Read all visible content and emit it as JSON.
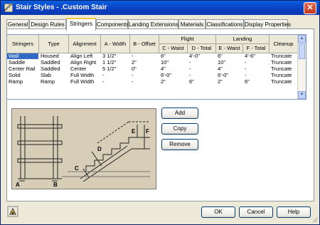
{
  "window": {
    "title": "Stair Styles - .Custom Stair",
    "close_glyph": "✕"
  },
  "tabs": [
    {
      "label": "General",
      "active": false
    },
    {
      "label": "Design Rules",
      "active": false
    },
    {
      "label": "Stringers",
      "active": true
    },
    {
      "label": "Components",
      "active": false
    },
    {
      "label": "Landing Extensions",
      "active": false
    },
    {
      "label": "Materials",
      "active": false
    },
    {
      "label": "Classifications",
      "active": false
    },
    {
      "label": "Display Properties",
      "active": false
    }
  ],
  "grid": {
    "headers": {
      "stringers": "Stringers",
      "type": "Type",
      "alignment": "Alignment",
      "a_width": "A - Width",
      "b_offset": "B - Offset",
      "flight": "Flight",
      "c_waist": "C - Waist",
      "d_total": "D - Total",
      "landing": "Landing",
      "e_waist": "E - Waist",
      "f_total": "F - Total",
      "cleanup": "Cleanup"
    },
    "rows": [
      [
        "Wall",
        "Housed",
        "Align Left",
        "3 1/2\"",
        "-",
        "6\"",
        "4'-0\"",
        "6\"",
        "4'-6\"",
        "Truncate"
      ],
      [
        "Saddle",
        "Saddled",
        "Align Right",
        "1 1/2\"",
        "2\"",
        "10\"",
        "-",
        "10\"",
        "-",
        "Truncate"
      ],
      [
        "Center Rail",
        "Saddled",
        "Center",
        "5 1/2\"",
        "0\"",
        "4\"",
        "-",
        "4\"",
        "-",
        "Truncate"
      ],
      [
        "Solid",
        "Slab",
        "Full Width",
        "-",
        "-",
        "6'-0\"",
        "-",
        "6'-0\"",
        "-",
        "Truncate"
      ],
      [
        "Ramp",
        "Ramp",
        "Full Width",
        "-",
        "-",
        "2\"",
        "6\"",
        "2\"",
        "6\"",
        "Truncate"
      ]
    ],
    "selected_row": 0
  },
  "diagram": {
    "labels": [
      "A",
      "B",
      "C",
      "D",
      "E",
      "F"
    ]
  },
  "buttons": {
    "add": "Add",
    "copy": "Copy",
    "remove": "Remove",
    "ok": "OK",
    "cancel": "Cancel",
    "help": "Help"
  },
  "icons": {
    "title": "stair-styles-icon",
    "help": "help-tool-icon"
  }
}
